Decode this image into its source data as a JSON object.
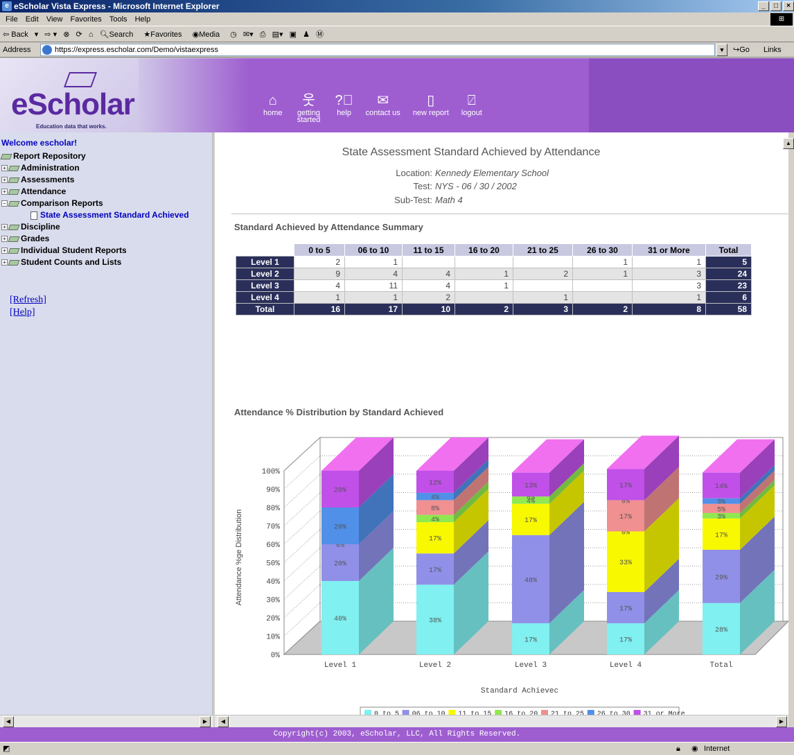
{
  "window": {
    "title": "eScholar Vista Express - Microsoft Internet Explorer"
  },
  "menu": [
    "File",
    "Edit",
    "View",
    "Favorites",
    "Tools",
    "Help"
  ],
  "toolbar": {
    "back": "Back",
    "search": "Search",
    "favorites": "Favorites",
    "media": "Media"
  },
  "address": {
    "label": "Address",
    "url": "https://express.escholar.com/Demo/vistaexpress",
    "go": "Go",
    "links": "Links"
  },
  "banner": {
    "logo": "eScholar",
    "tagline": "Education data that works.",
    "nav": [
      {
        "label": "home",
        "icon": "home-icon"
      },
      {
        "label": "getting started",
        "icon": "person-icon"
      },
      {
        "label": "help",
        "icon": "question-icon"
      },
      {
        "label": "contact us",
        "icon": "envelope-icon"
      },
      {
        "label": "new report",
        "icon": "new-document-icon"
      },
      {
        "label": "logout",
        "icon": "door-icon"
      }
    ]
  },
  "sidebar": {
    "welcome": "Welcome escholar!",
    "root": "Report Repository",
    "items": [
      {
        "label": "Administration",
        "state": "+"
      },
      {
        "label": "Assessments",
        "state": "+"
      },
      {
        "label": "Attendance",
        "state": "+"
      },
      {
        "label": "Comparison Reports",
        "state": "-"
      },
      {
        "label": "State Assessment Standard Achieved",
        "state": "selected"
      },
      {
        "label": "Discipline",
        "state": "+"
      },
      {
        "label": "Grades",
        "state": "+"
      },
      {
        "label": "Individual Student Reports",
        "state": "+"
      },
      {
        "label": "Student Counts and Lists",
        "state": "+"
      }
    ],
    "refresh": "[Refresh]",
    "help": "[Help]"
  },
  "report": {
    "title": "State Assessment Standard Achieved by Attendance",
    "location_label": "Location:",
    "location": "Kennedy Elementary School",
    "test_label": "Test:",
    "test": "NYS - 06 / 30 / 2002",
    "subtest_label": "Sub-Test:",
    "subtest": "Math 4",
    "summary_title": "Standard Achieved by Attendance Summary",
    "chart_title": "Attendance % Distribution by Standard Achieved"
  },
  "table": {
    "headers": [
      "",
      "0 to 5",
      "06 to 10",
      "11 to 15",
      "16 to 20",
      "21 to 25",
      "26 to 30",
      "31 or More",
      "Total"
    ],
    "rows": [
      [
        "Level 1",
        "2",
        "1",
        "",
        "",
        "",
        "1",
        "1",
        "5"
      ],
      [
        "Level 2",
        "9",
        "4",
        "4",
        "1",
        "2",
        "1",
        "3",
        "24"
      ],
      [
        "Level 3",
        "4",
        "11",
        "4",
        "1",
        "",
        "",
        "3",
        "23"
      ],
      [
        "Level 4",
        "1",
        "1",
        "2",
        "",
        "1",
        "",
        "1",
        "6"
      ],
      [
        "Total",
        "16",
        "17",
        "10",
        "2",
        "3",
        "2",
        "8",
        "58"
      ]
    ]
  },
  "chart_data": {
    "type": "bar",
    "stacked": true,
    "title": "Attendance % Distribution by Standard Achieved",
    "xlabel": "Standard Achievec",
    "ylabel": "Attendance %ge Distribution",
    "ylim": [
      0,
      100
    ],
    "yticks": [
      "0%",
      "10%",
      "20%",
      "30%",
      "40%",
      "50%",
      "60%",
      "70%",
      "80%",
      "90%",
      "100%"
    ],
    "categories": [
      "Level 1",
      "Level 2",
      "Level 3",
      "Level 4",
      "Total"
    ],
    "series": [
      {
        "name": "0 to 5",
        "color": "#80f0f0",
        "values": [
          40,
          38,
          17,
          17,
          28
        ],
        "labels": [
          "40%",
          "38%",
          "17%",
          "17%",
          "28%"
        ]
      },
      {
        "name": "06 to 10",
        "color": "#9090e8",
        "values": [
          20,
          17,
          48,
          17,
          29
        ],
        "labels": [
          "20%",
          "17%",
          "48%",
          "17%",
          "29%"
        ]
      },
      {
        "name": "11 to 15",
        "color": "#f8f800",
        "values": [
          0,
          17,
          17,
          33,
          17
        ],
        "labels": [
          "",
          "17%",
          "17%",
          "33%",
          "17%"
        ]
      },
      {
        "name": "16 to 20",
        "color": "#90e850",
        "values": [
          0,
          4,
          4,
          0,
          3
        ],
        "labels": [
          "",
          "4%",
          "4%",
          "0%",
          "3%"
        ]
      },
      {
        "name": "21 to 25",
        "color": "#f09090",
        "values": [
          0,
          8,
          0,
          17,
          5
        ],
        "labels": [
          "0%",
          "8%",
          "0%",
          "17%",
          "5%"
        ]
      },
      {
        "name": "26 to 30",
        "color": "#5090e8",
        "values": [
          20,
          4,
          0,
          0,
          3
        ],
        "labels": [
          "20%",
          "4%",
          "",
          "0%",
          "3%"
        ]
      },
      {
        "name": "31 or More",
        "color": "#c050e8",
        "values": [
          20,
          12,
          13,
          17,
          14
        ],
        "labels": [
          "20%",
          "12%",
          "13%",
          "17%",
          "14%"
        ]
      }
    ],
    "legend": "bottom"
  },
  "footer": {
    "copyright": "Copyright(c) 2003, eScholar, LLC, All Rights Reserved."
  },
  "status": {
    "zone": "Internet"
  }
}
